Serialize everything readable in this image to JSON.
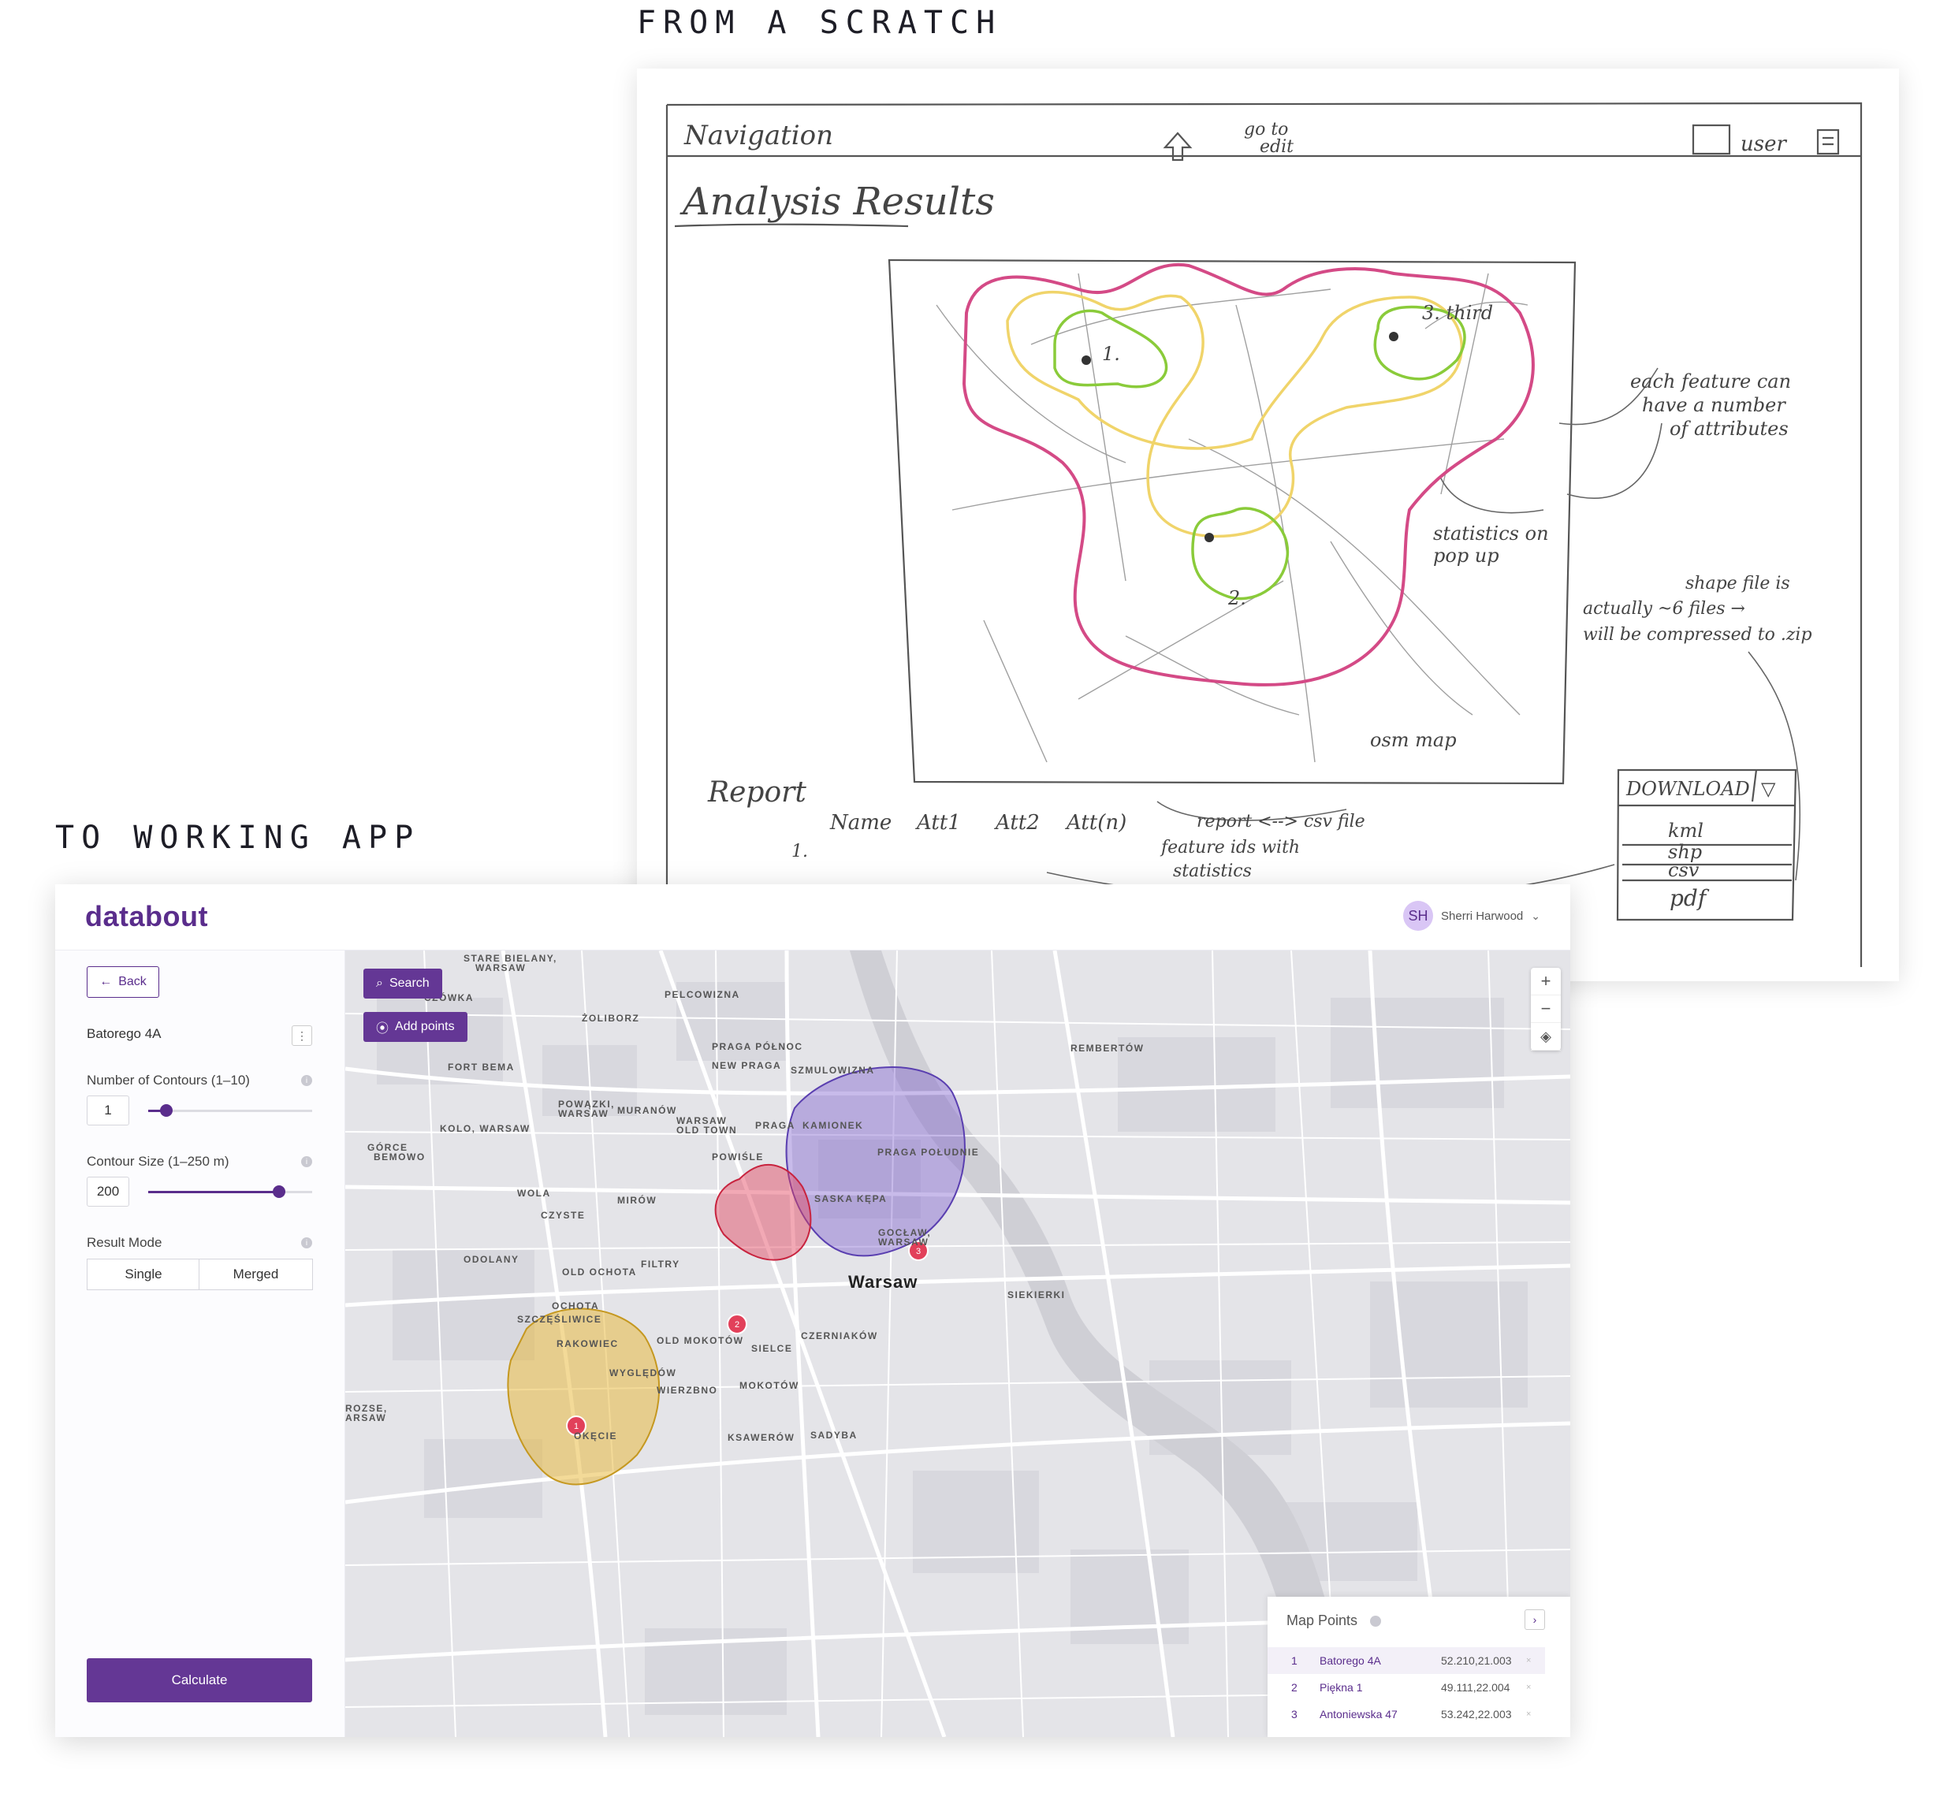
{
  "headings": {
    "top": "FROM A SCRATCH",
    "bottom": "TO WORKING APP"
  },
  "sketch": {
    "nav": "Navigation",
    "go_edit_1": "go to",
    "go_edit_2": "edit",
    "user": "user",
    "title": "Analysis Results",
    "p1": "1.",
    "p2": "2.",
    "p3": "3. third",
    "note_features": [
      "each feature can",
      "have a number",
      "of attributes"
    ],
    "note_stats": [
      "statistics on",
      "pop up"
    ],
    "note_shape": [
      "shape file is",
      "actually ~6 files →",
      "will be compressed to .zip"
    ],
    "osm": "osm map",
    "report": "Report",
    "cols": [
      "Name",
      "Att1",
      "Att2",
      "Att(n)"
    ],
    "row1": "1.",
    "note_report": [
      "report <--> csv file",
      "feature ids with",
      "statistics"
    ],
    "download": "DOWNLOAD",
    "download_items": [
      "kml",
      "shp",
      "csv",
      "pdf"
    ]
  },
  "app": {
    "logo": "databout",
    "user": {
      "initials": "SH",
      "name": "Sherri Harwood"
    },
    "sidebar": {
      "back": "Back",
      "address": "Batorego 4A",
      "contours_label": "Number of Contours (1–10)",
      "contours_value": "1",
      "contours_fraction": 0.11,
      "size_label": "Contour Size (1–250 m)",
      "size_value": "200",
      "size_fraction": 0.8,
      "mode_label": "Result Mode",
      "mode_single": "Single",
      "mode_merged": "Merged",
      "calculate": "Calculate"
    },
    "map": {
      "search": "Search",
      "add_points": "Add points",
      "city": "Warsaw",
      "districts": [
        "STARE BIELANY,",
        "WARSAW",
        "CZÓWKA",
        "PELCOWIZNA",
        "ŻOLIBORZ",
        "PRAGA PÓŁNOC",
        "REMBERTÓW",
        "NEW PRAGA",
        "FORT BEMA",
        "SZMULOWIZNA",
        "POWĄZKI,",
        "WARSAW",
        "MURANÓW",
        "WARSAW",
        "OLD TOWN",
        "PRAGA",
        "KAMIONEK",
        "KOLO, WARSAW",
        "GÓRCE",
        "BEMOWO",
        "PRAGA POŁUDNIE",
        "POWIŚLE",
        "WOLA",
        "MIRÓW",
        "SASKA KĘPA",
        "CZYSTE",
        "GOCŁAW,",
        "WARSAW",
        "ODOLANY",
        "FILTRY",
        "OLD OCHOTA",
        "SIEKIERKI",
        "OCHOTA",
        "SZCZĘŚLIWICE",
        "RAKOWIEC",
        "OLD MOKOTÓW",
        "CZERNIAKÓW",
        "SIELCE",
        "WYGLĘDÓW",
        "WIERZBNO",
        "MOKOTÓW",
        "SADYBA",
        "OKĘCIE",
        "KSAWERÓW",
        "ROZSE,",
        "ARSAW"
      ],
      "markers": [
        "1",
        "2",
        "3"
      ],
      "zoom_in": "+",
      "zoom_out": "−",
      "points_title": "Map Points",
      "points": [
        {
          "idx": "1",
          "name": "Batorego 4A",
          "coord": "52.210,21.003"
        },
        {
          "idx": "2",
          "name": "Piękna 1",
          "coord": "49.111,22.004"
        },
        {
          "idx": "3",
          "name": "Antoniewska 47",
          "coord": "53.242,22.003"
        }
      ],
      "colors": {
        "purple": "#7b5ccc",
        "red": "#e2405a",
        "yellow": "#e7b531",
        "accent": "#643795"
      }
    }
  }
}
